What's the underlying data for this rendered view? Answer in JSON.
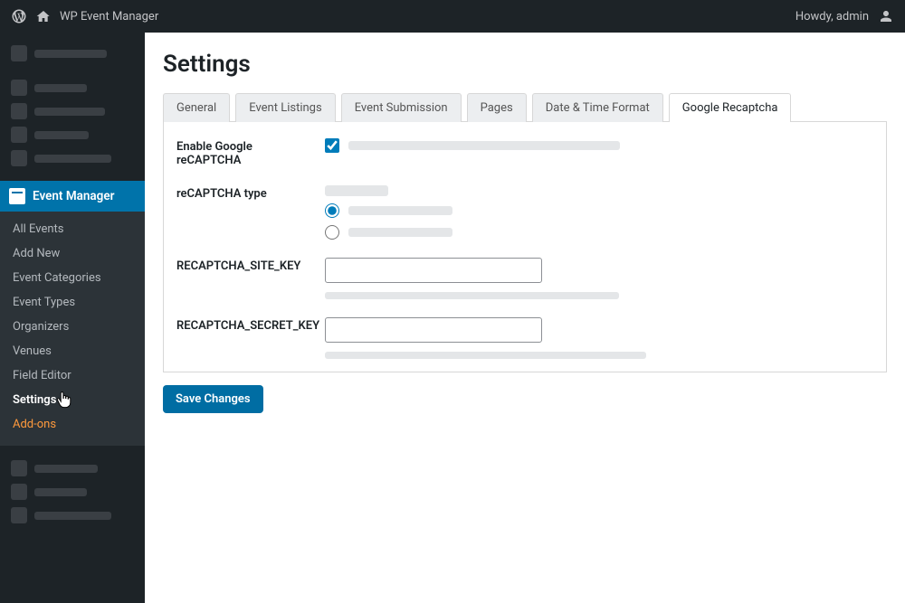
{
  "topbar": {
    "site_name": "WP Event Manager",
    "greeting": "Howdy, admin"
  },
  "sidebar": {
    "active_label": "Event Manager",
    "submenu": [
      "All Events",
      "Add New",
      "Event Categories",
      "Event Types",
      "Organizers",
      "Venues",
      "Field Editor",
      "Settings",
      "Add-ons"
    ]
  },
  "page": {
    "title": "Settings",
    "save_label": "Save Changes"
  },
  "tabs": [
    "General",
    "Event Listings",
    "Event Submission",
    "Pages",
    "Date & Time Format",
    "Google Recaptcha"
  ],
  "form": {
    "enable_label": "Enable Google reCAPTCHA",
    "type_label": "reCAPTCHA type",
    "site_key_label": "RECAPTCHA_SITE_KEY",
    "secret_key_label": "RECAPTCHA_SECRET_KEY",
    "enable_checked": true,
    "radio_selected": 0
  }
}
